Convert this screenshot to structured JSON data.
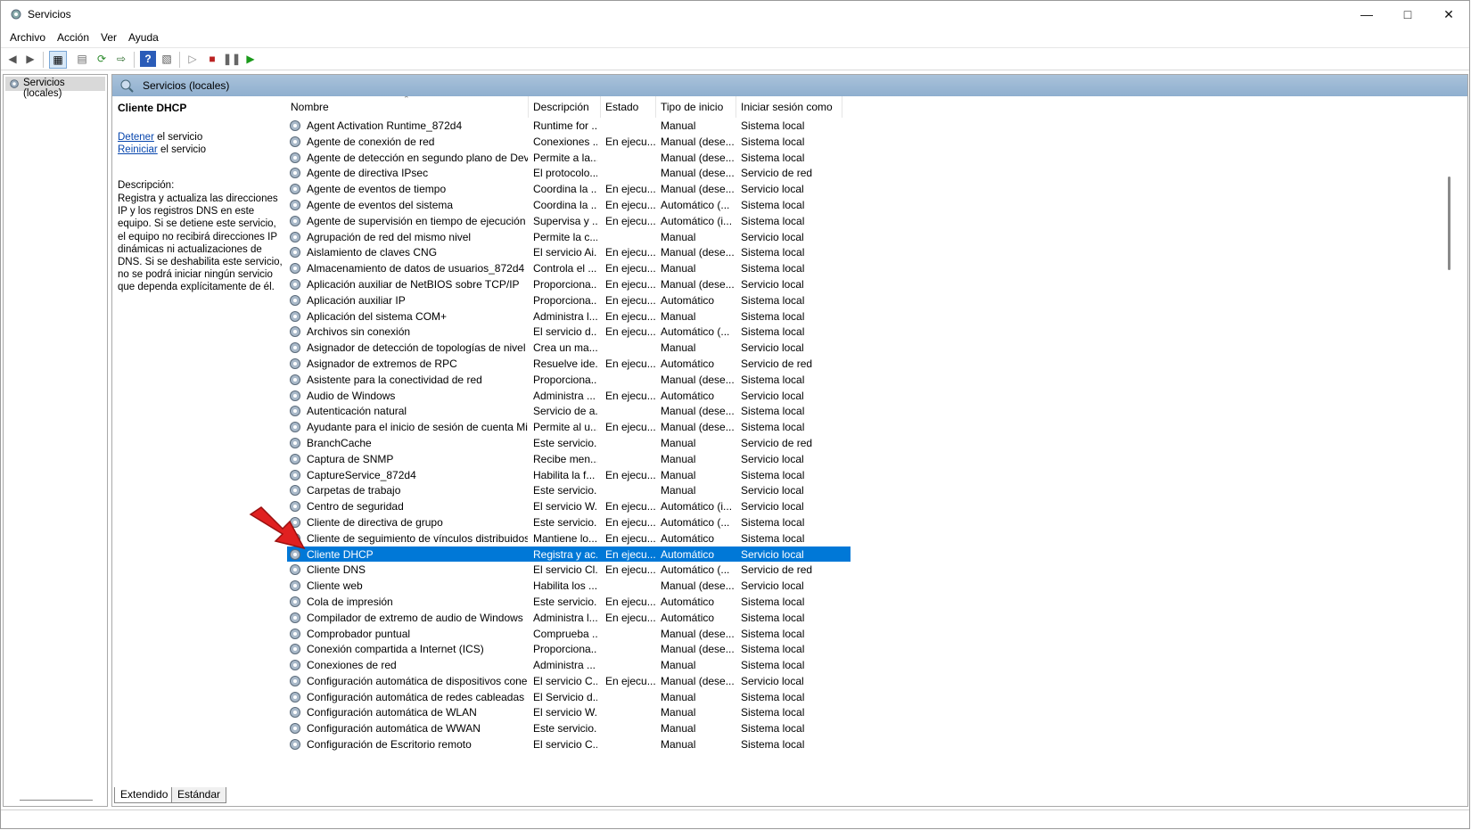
{
  "window": {
    "title": "Servicios",
    "icon": "gear-icon",
    "controls": [
      "minimize-icon",
      "maximize-icon",
      "close-icon"
    ]
  },
  "menu": [
    "Archivo",
    "Acción",
    "Ver",
    "Ayuda"
  ],
  "toolbar": [
    "back-icon",
    "forward-icon",
    "show-console-tree-icon",
    "properties-icon",
    "refresh-icon",
    "export-list-icon",
    "help-icon",
    "view-icon",
    "play-icon",
    "stop-icon",
    "pause-icon",
    "resume-icon"
  ],
  "tree": {
    "root": "Servicios (locales)"
  },
  "banner": {
    "title": "Servicios (locales)"
  },
  "details": {
    "title": "Cliente DHCP",
    "stop_link": "Detener",
    "stop_rest": " el servicio",
    "restart_link": "Reiniciar",
    "restart_rest": " el servicio",
    "desc_label": "Descripción:",
    "desc_text": "Registra y actualiza las direcciones IP y los registros DNS en este equipo. Si se detiene este servicio, el equipo no recibirá direcciones IP dinámicas ni actualizaciones de DNS. Si se deshabilita este servicio, no se podrá iniciar ningún servicio que dependa explícitamente de él."
  },
  "columns": [
    "Nombre",
    "Descripción",
    "Estado",
    "Tipo de inicio",
    "Iniciar sesión como"
  ],
  "selected_index": 27,
  "rows": [
    [
      "Agent Activation Runtime_872d4",
      "Runtime for ...",
      "",
      "Manual",
      "Sistema local"
    ],
    [
      "Agente de conexión de red",
      "Conexiones ...",
      "En ejecu...",
      "Manual (dese...",
      "Sistema local"
    ],
    [
      "Agente de detección en segundo plano de DevQ...",
      "Permite a la...",
      "",
      "Manual (dese...",
      "Sistema local"
    ],
    [
      "Agente de directiva IPsec",
      "El protocolo...",
      "",
      "Manual (dese...",
      "Servicio de red"
    ],
    [
      "Agente de eventos de tiempo",
      "Coordina la ...",
      "En ejecu...",
      "Manual (dese...",
      "Servicio local"
    ],
    [
      "Agente de eventos del sistema",
      "Coordina la ...",
      "En ejecu...",
      "Automático (...",
      "Sistema local"
    ],
    [
      "Agente de supervisión en tiempo de ejecución d...",
      "Supervisa y ...",
      "En ejecu...",
      "Automático (i...",
      "Sistema local"
    ],
    [
      "Agrupación de red del mismo nivel",
      "Permite la c...",
      "",
      "Manual",
      "Servicio local"
    ],
    [
      "Aislamiento de claves CNG",
      "El servicio Ai...",
      "En ejecu...",
      "Manual (dese...",
      "Sistema local"
    ],
    [
      "Almacenamiento de datos de usuarios_872d4",
      "Controla el ...",
      "En ejecu...",
      "Manual",
      "Sistema local"
    ],
    [
      "Aplicación auxiliar de NetBIOS sobre TCP/IP",
      "Proporciona...",
      "En ejecu...",
      "Manual (dese...",
      "Servicio local"
    ],
    [
      "Aplicación auxiliar IP",
      "Proporciona...",
      "En ejecu...",
      "Automático",
      "Sistema local"
    ],
    [
      "Aplicación del sistema COM+",
      "Administra l...",
      "En ejecu...",
      "Manual",
      "Sistema local"
    ],
    [
      "Archivos sin conexión",
      "El servicio d...",
      "En ejecu...",
      "Automático (...",
      "Sistema local"
    ],
    [
      "Asignador de detección de topologías de nivel d...",
      "Crea un ma...",
      "",
      "Manual",
      "Servicio local"
    ],
    [
      "Asignador de extremos de RPC",
      "Resuelve ide...",
      "En ejecu...",
      "Automático",
      "Servicio de red"
    ],
    [
      "Asistente para la conectividad de red",
      "Proporciona...",
      "",
      "Manual (dese...",
      "Sistema local"
    ],
    [
      "Audio de Windows",
      "Administra ...",
      "En ejecu...",
      "Automático",
      "Servicio local"
    ],
    [
      "Autenticación natural",
      "Servicio de a...",
      "",
      "Manual (dese...",
      "Sistema local"
    ],
    [
      "Ayudante para el inicio de sesión de cuenta Micr...",
      "Permite al u...",
      "En ejecu...",
      "Manual (dese...",
      "Sistema local"
    ],
    [
      "BranchCache",
      "Este servicio...",
      "",
      "Manual",
      "Servicio de red"
    ],
    [
      "Captura de SNMP",
      "Recibe men...",
      "",
      "Manual",
      "Servicio local"
    ],
    [
      "CaptureService_872d4",
      "Habilita la f...",
      "En ejecu...",
      "Manual",
      "Sistema local"
    ],
    [
      "Carpetas de trabajo",
      "Este servicio...",
      "",
      "Manual",
      "Servicio local"
    ],
    [
      "Centro de seguridad",
      "El servicio W...",
      "En ejecu...",
      "Automático (i...",
      "Servicio local"
    ],
    [
      "Cliente de directiva de grupo",
      "Este servicio...",
      "En ejecu...",
      "Automático (...",
      "Sistema local"
    ],
    [
      "Cliente de seguimiento de vínculos distribuidos",
      "Mantiene lo...",
      "En ejecu...",
      "Automático",
      "Sistema local"
    ],
    [
      "Cliente DHCP",
      "Registra y ac...",
      "En ejecu...",
      "Automático",
      "Servicio local"
    ],
    [
      "Cliente DNS",
      "El servicio Cl...",
      "En ejecu...",
      "Automático (...",
      "Servicio de red"
    ],
    [
      "Cliente web",
      "Habilita los ...",
      "",
      "Manual (dese...",
      "Servicio local"
    ],
    [
      "Cola de impresión",
      "Este servicio...",
      "En ejecu...",
      "Automático",
      "Sistema local"
    ],
    [
      "Compilador de extremo de audio de Windows",
      "Administra l...",
      "En ejecu...",
      "Automático",
      "Sistema local"
    ],
    [
      "Comprobador puntual",
      "Comprueba ...",
      "",
      "Manual (dese...",
      "Sistema local"
    ],
    [
      "Conexión compartida a Internet (ICS)",
      "Proporciona...",
      "",
      "Manual (dese...",
      "Sistema local"
    ],
    [
      "Conexiones de red",
      "Administra ...",
      "",
      "Manual",
      "Sistema local"
    ],
    [
      "Configuración automática de dispositivos conec...",
      "El servicio C...",
      "En ejecu...",
      "Manual (dese...",
      "Servicio local"
    ],
    [
      "Configuración automática de redes cableadas",
      "El Servicio d...",
      "",
      "Manual",
      "Sistema local"
    ],
    [
      "Configuración automática de WLAN",
      "El servicio W...",
      "",
      "Manual",
      "Sistema local"
    ],
    [
      "Configuración automática de WWAN",
      "Este servicio...",
      "",
      "Manual",
      "Sistema local"
    ],
    [
      "Configuración de Escritorio remoto",
      "El servicio C...",
      "",
      "Manual",
      "Sistema local"
    ]
  ],
  "tabs": [
    "Extendido",
    "Estándar"
  ],
  "colors": {
    "selection": "#0078d7",
    "banner": "#9bb8d5",
    "link": "#0645ad",
    "arrow": "#e02020"
  }
}
